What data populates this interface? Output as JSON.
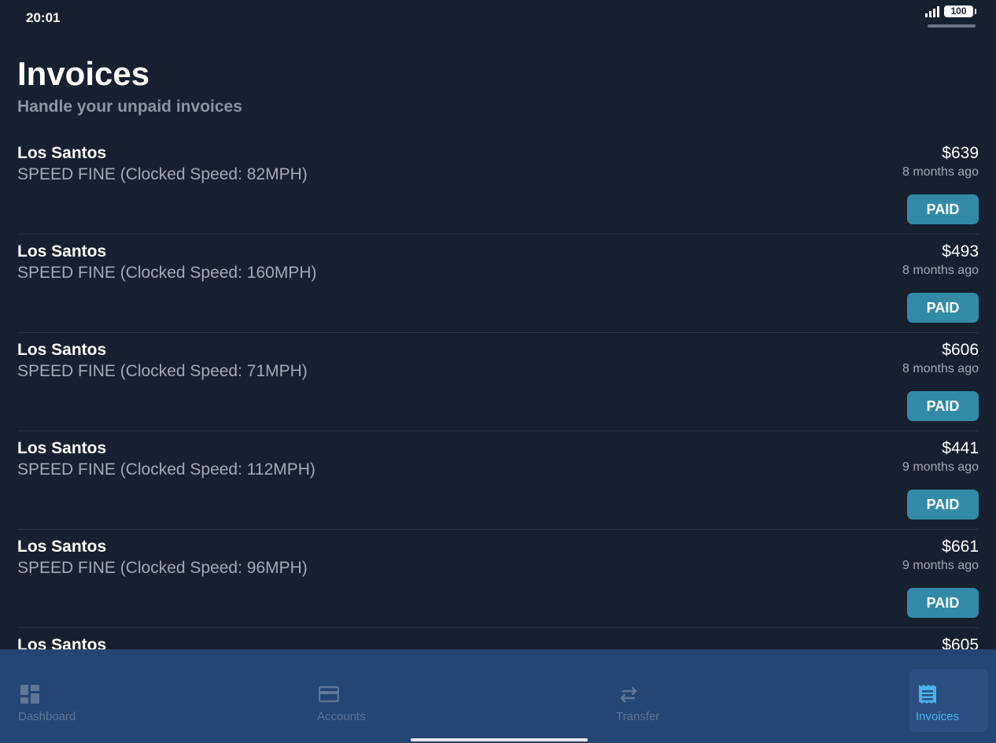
{
  "status_bar": {
    "time": "20:01",
    "battery_level": "100"
  },
  "header": {
    "title": "Invoices",
    "subtitle": "Handle your unpaid invoices"
  },
  "invoices": [
    {
      "location": "Los Santos",
      "reason": "SPEED FINE (Clocked Speed: 82MPH)",
      "amount": "$639",
      "time": "8 months ago",
      "status_label": "PAID"
    },
    {
      "location": "Los Santos",
      "reason": "SPEED FINE (Clocked Speed: 160MPH)",
      "amount": "$493",
      "time": "8 months ago",
      "status_label": "PAID"
    },
    {
      "location": "Los Santos",
      "reason": "SPEED FINE (Clocked Speed: 71MPH)",
      "amount": "$606",
      "time": "8 months ago",
      "status_label": "PAID"
    },
    {
      "location": "Los Santos",
      "reason": "SPEED FINE (Clocked Speed: 112MPH)",
      "amount": "$441",
      "time": "9 months ago",
      "status_label": "PAID"
    },
    {
      "location": "Los Santos",
      "reason": "SPEED FINE (Clocked Speed: 96MPH)",
      "amount": "$661",
      "time": "9 months ago",
      "status_label": "PAID"
    },
    {
      "location": "Los Santos",
      "reason": "",
      "amount": "$605",
      "time": "",
      "status_label": ""
    }
  ],
  "nav": {
    "items": [
      {
        "label": "Dashboard",
        "icon": "dashboard-icon"
      },
      {
        "label": "Accounts",
        "icon": "credit-card-icon"
      },
      {
        "label": "Transfer",
        "icon": "transfer-arrows-icon"
      },
      {
        "label": "Invoices",
        "icon": "receipt-icon"
      }
    ],
    "active": "Invoices"
  },
  "colors": {
    "background": "#16202e",
    "nav_background": "#244675",
    "paid_button": "#338aa6",
    "active_nav": "#4ab3ea",
    "inactive_nav": "#5e7698"
  }
}
